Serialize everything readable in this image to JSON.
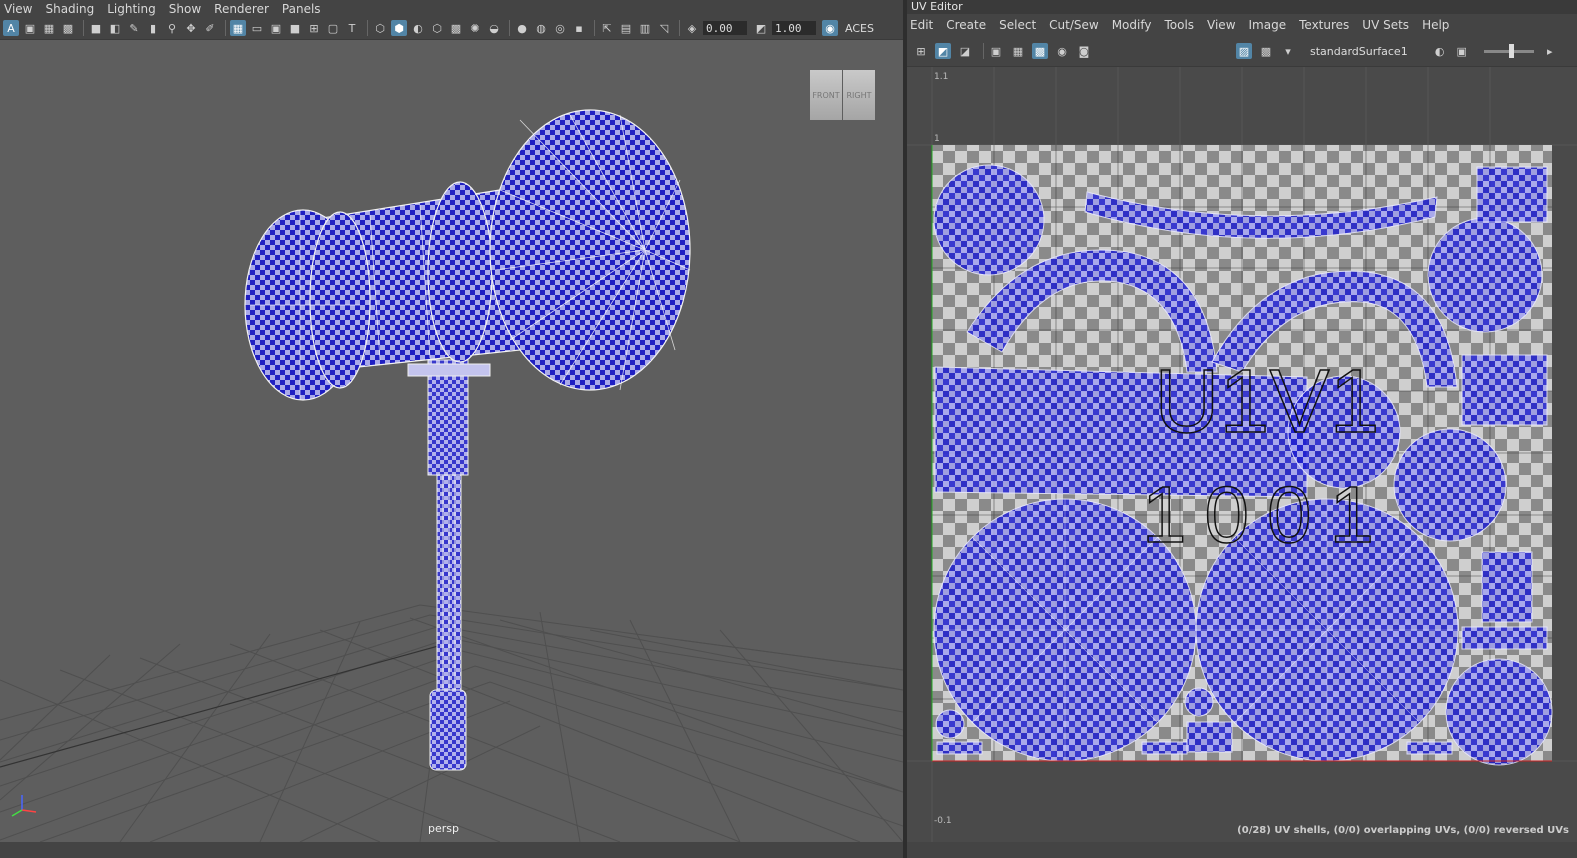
{
  "viewport": {
    "menu": [
      "View",
      "Shading",
      "Lighting",
      "Show",
      "Renderer",
      "Panels"
    ],
    "toolbar": {
      "exposure_value": "0.00",
      "gamma_value": "1.00",
      "color_space_label": "ACES"
    },
    "camera_label": "persp",
    "viewcube": {
      "front": "FRONT",
      "right": "RIGHT"
    }
  },
  "uv_editor": {
    "title": "UV Editor",
    "menu": [
      "Edit",
      "Create",
      "Select",
      "Cut/Sew",
      "Modify",
      "Tools",
      "View",
      "Image",
      "Textures",
      "UV Sets",
      "Help"
    ],
    "shader_name": "standardSurface1",
    "grid_labels": {
      "top": "1.1",
      "one": "1",
      "bottom": "-0.1"
    },
    "tile_label_top": "U1V1",
    "tile_label_bottom": "1001",
    "status": "(0/28) UV shells, (0/0) overlapping UVs, (0/0) reversed UVs"
  },
  "colors": {
    "uv_blue": "#3b3bdc",
    "checker_dark": "#1a1ab8",
    "checker_light": "#9a9adf",
    "viewport_bg": "#5e5e5e",
    "accent": "#5285a6"
  }
}
